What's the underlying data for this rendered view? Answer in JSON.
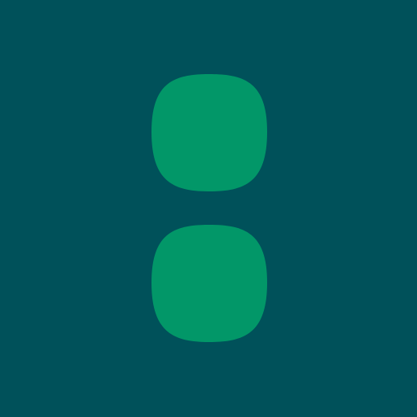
{
  "background_color": "#00515a",
  "shape_color": "#029768",
  "shapes": [
    {
      "name": "top-rounded-square"
    },
    {
      "name": "bottom-rounded-square"
    }
  ]
}
